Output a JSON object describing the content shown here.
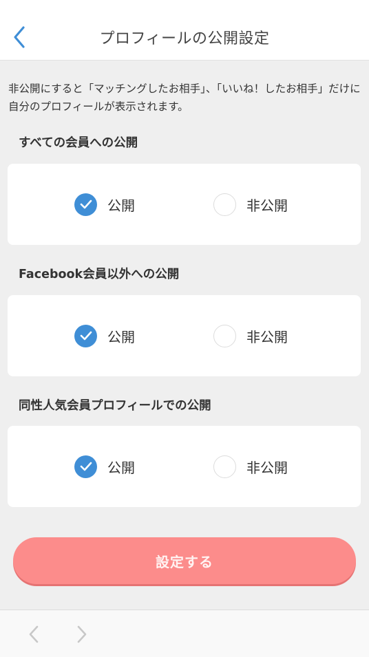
{
  "header": {
    "title": "プロフィールの公開設定",
    "back_icon": "chevron-left-icon"
  },
  "description": "非公開にすると「マッチングしたお相手」、「いいね！したお相手」だけに自分のプロフィールが表示されます。",
  "sections": [
    {
      "label": "すべての会員への公開",
      "options": [
        {
          "label": "公開",
          "checked": true
        },
        {
          "label": "非公開",
          "checked": false
        }
      ]
    },
    {
      "label": "Facebook会員以外への公開",
      "options": [
        {
          "label": "公開",
          "checked": true
        },
        {
          "label": "非公開",
          "checked": false
        }
      ]
    },
    {
      "label": "同性人気会員プロフィールでの公開",
      "options": [
        {
          "label": "公開",
          "checked": true
        },
        {
          "label": "非公開",
          "checked": false
        }
      ]
    }
  ],
  "submit": {
    "label": "設定する"
  },
  "browser_bar": {
    "back_icon": "chevron-left-icon",
    "forward_icon": "chevron-right-icon"
  },
  "colors": {
    "accent": "#3f8ed6",
    "submit": "#fc8c8b",
    "background": "#efefef"
  }
}
